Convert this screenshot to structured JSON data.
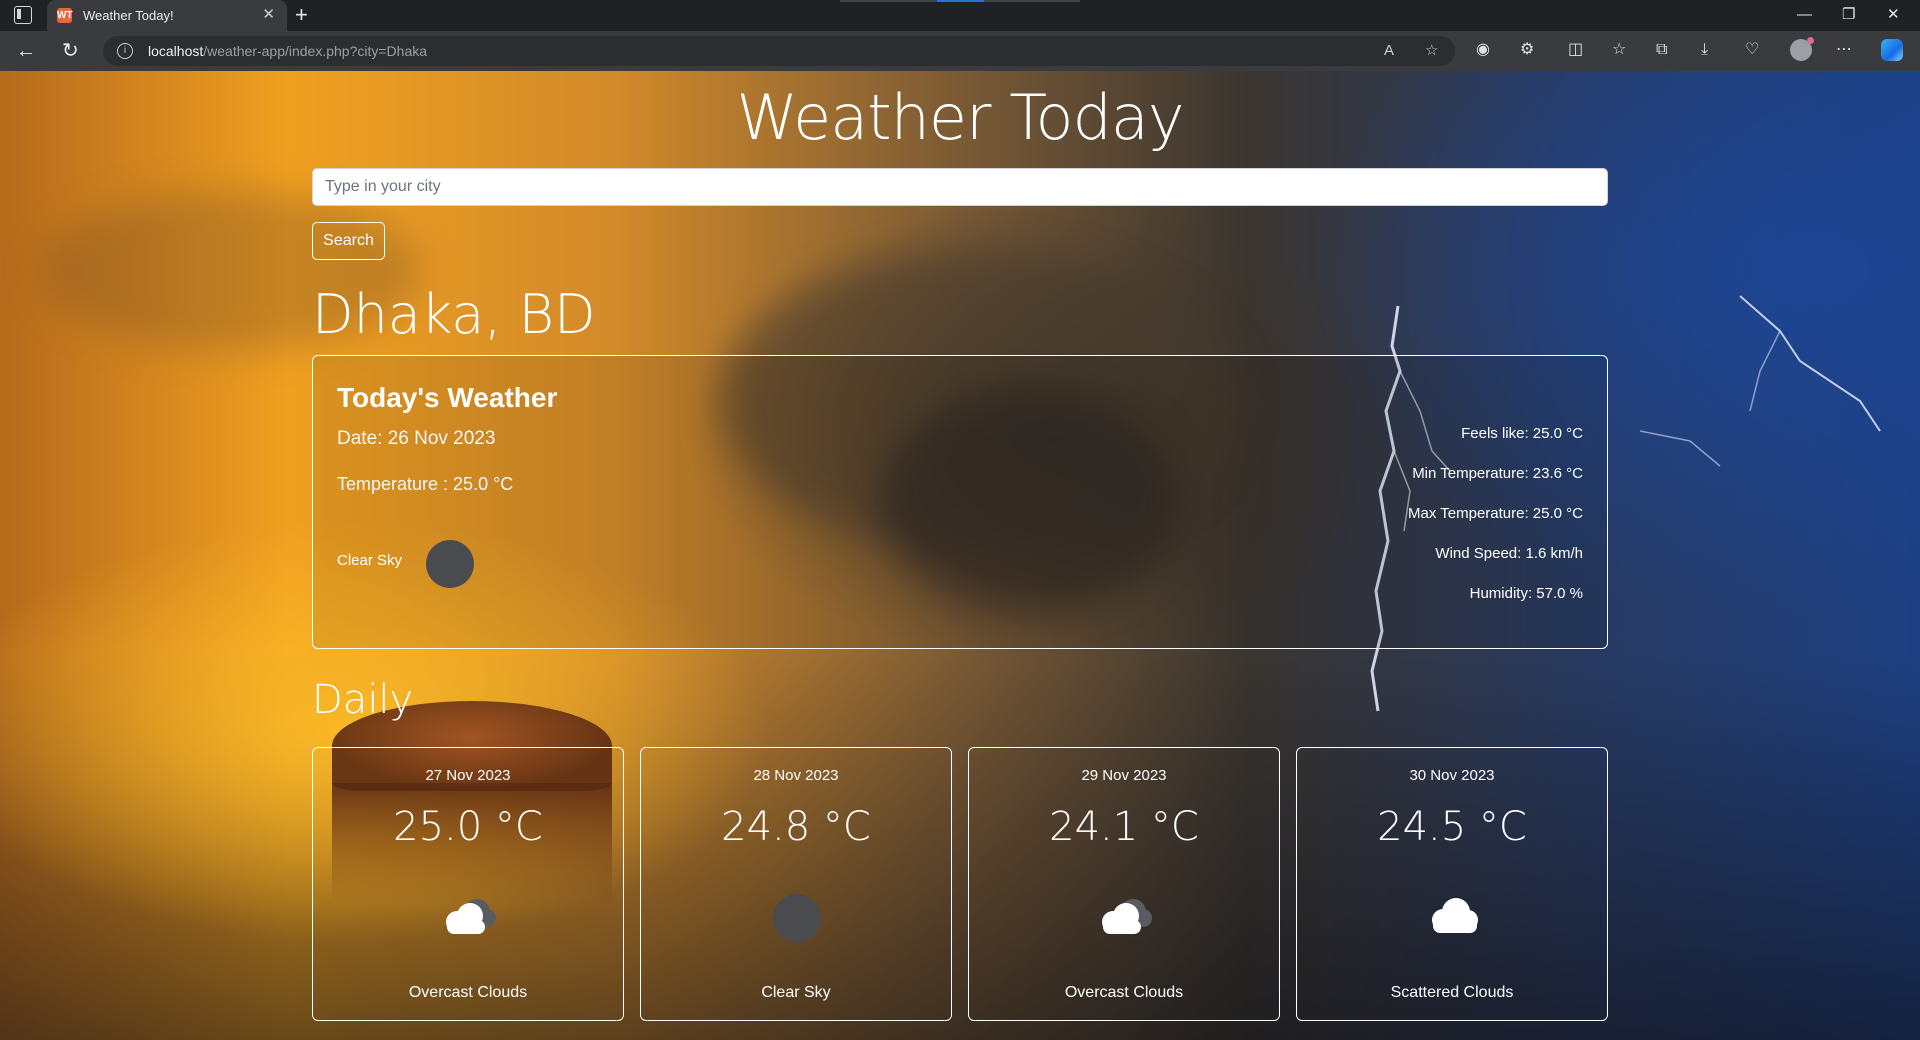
{
  "browser": {
    "tab_title": "Weather Today!",
    "tab_favicon": "WT",
    "url_host": "localhost",
    "url_path": "/weather-app/index.php?city=Dhaka"
  },
  "page": {
    "title": "Weather Today",
    "search_placeholder": "Type in your city",
    "search_button": "Search",
    "city": "Dhaka, BD"
  },
  "today": {
    "heading": "Today's Weather",
    "date": "Date: 26 Nov 2023",
    "temperature": "Temperature : 25.0 °C",
    "condition": "Clear Sky",
    "icon": "clear-sky-icon",
    "stats": [
      "Feels like: 25.0 °C",
      "Min Temperature: 23.6 °C",
      "Max Temperature: 25.0 °C",
      "Wind Speed: 1.6 km/h",
      "Humidity: 57.0 %"
    ]
  },
  "daily": {
    "title": "Daily",
    "days": [
      {
        "date": "27 Nov 2023",
        "temp": "25.0 °C",
        "desc": "Overcast Clouds",
        "icon": "overcast-clouds-icon"
      },
      {
        "date": "28 Nov 2023",
        "temp": "24.8 °C",
        "desc": "Clear Sky",
        "icon": "clear-sky-icon"
      },
      {
        "date": "29 Nov 2023",
        "temp": "24.1 °C",
        "desc": "Overcast Clouds",
        "icon": "overcast-clouds-icon"
      },
      {
        "date": "30 Nov 2023",
        "temp": "24.5 °C",
        "desc": "Scattered Clouds",
        "icon": "scattered-clouds-icon"
      }
    ]
  }
}
